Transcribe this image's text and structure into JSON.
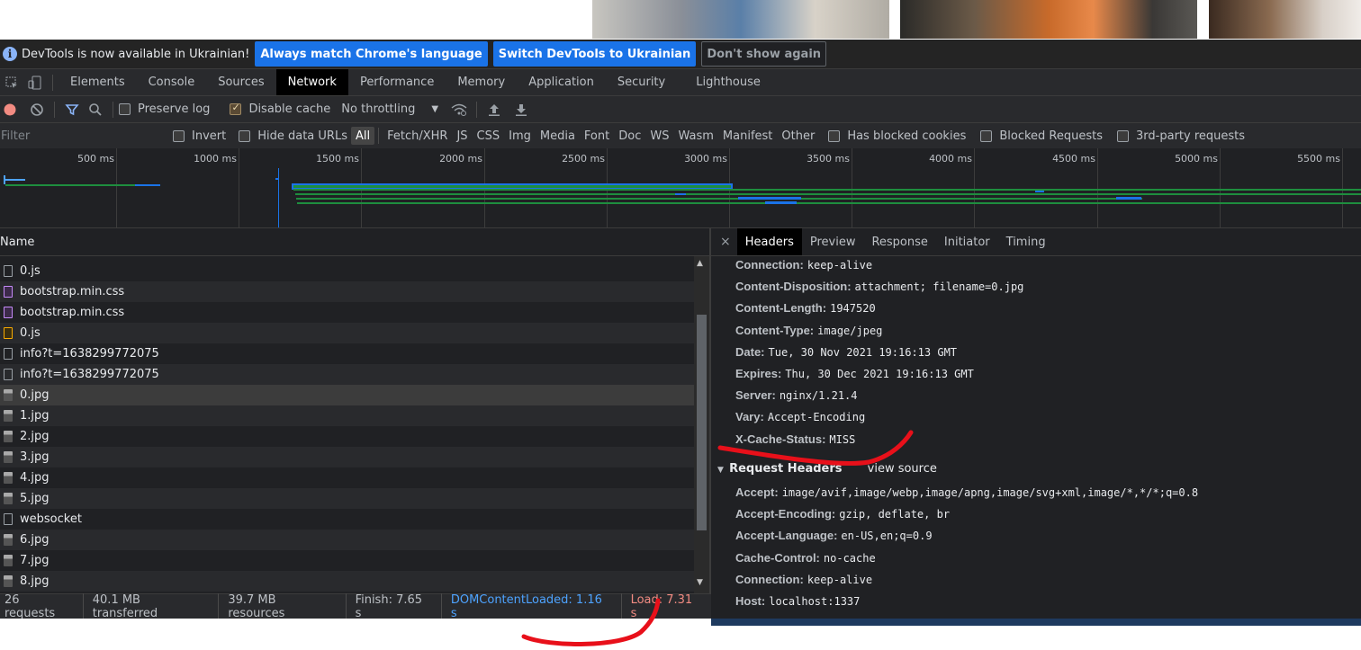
{
  "infobar": {
    "message": "DevTools is now available in Ukrainian!",
    "btn_match": "Always match Chrome's language",
    "btn_switch": "Switch DevTools to Ukrainian",
    "btn_dismiss": "Don't show again"
  },
  "tabs": [
    "Elements",
    "Console",
    "Sources",
    "Network",
    "Performance",
    "Memory",
    "Application",
    "Security",
    "Lighthouse"
  ],
  "active_tab": "Network",
  "toolbar": {
    "preserve_log": "Preserve log",
    "disable_cache": "Disable cache",
    "throttling": "No throttling"
  },
  "filterbar": {
    "placeholder": "Filter",
    "invert": "Invert",
    "hide_data_urls": "Hide data URLs",
    "types": [
      "All",
      "Fetch/XHR",
      "JS",
      "CSS",
      "Img",
      "Media",
      "Font",
      "Doc",
      "WS",
      "Wasm",
      "Manifest",
      "Other"
    ],
    "has_blocked_cookies": "Has blocked cookies",
    "blocked_requests": "Blocked Requests",
    "third_party": "3rd-party requests"
  },
  "overview": {
    "ticks": [
      "500 ms",
      "1000 ms",
      "1500 ms",
      "2000 ms",
      "2500 ms",
      "3000 ms",
      "3500 ms",
      "4000 ms",
      "4500 ms",
      "5000 ms",
      "5500 ms"
    ]
  },
  "requests": {
    "column_name": "Name",
    "rows": [
      {
        "name": "0.js",
        "type": "doc"
      },
      {
        "name": "bootstrap.min.css",
        "type": "css"
      },
      {
        "name": "bootstrap.min.css",
        "type": "css"
      },
      {
        "name": "0.js",
        "type": "js"
      },
      {
        "name": "info?t=1638299772075",
        "type": "doc"
      },
      {
        "name": "info?t=1638299772075",
        "type": "doc"
      },
      {
        "name": "0.jpg",
        "type": "img"
      },
      {
        "name": "1.jpg",
        "type": "img"
      },
      {
        "name": "2.jpg",
        "type": "img"
      },
      {
        "name": "3.jpg",
        "type": "img"
      },
      {
        "name": "4.jpg",
        "type": "img"
      },
      {
        "name": "5.jpg",
        "type": "img"
      },
      {
        "name": "websocket",
        "type": "doc"
      },
      {
        "name": "6.jpg",
        "type": "img"
      },
      {
        "name": "7.jpg",
        "type": "img"
      },
      {
        "name": "8.jpg",
        "type": "img"
      }
    ]
  },
  "status": {
    "requests": "26 requests",
    "transferred": "40.1 MB transferred",
    "resources": "39.7 MB resources",
    "finish": "Finish: 7.65 s",
    "dcl": "DOMContentLoaded: 1.16 s",
    "load": "Load: 7.31 s",
    "dcl_color": "#4da3ff",
    "load_color": "#f28b82"
  },
  "details": {
    "tabs": [
      "Headers",
      "Preview",
      "Response",
      "Initiator",
      "Timing"
    ],
    "close": "×",
    "response_headers": [
      {
        "name": "Connection:",
        "value": "keep-alive"
      },
      {
        "name": "Content-Disposition:",
        "value": "attachment; filename=0.jpg"
      },
      {
        "name": "Content-Length:",
        "value": "1947520"
      },
      {
        "name": "Content-Type:",
        "value": "image/jpeg"
      },
      {
        "name": "Date:",
        "value": "Tue, 30 Nov 2021 19:16:13 GMT"
      },
      {
        "name": "Expires:",
        "value": "Thu, 30 Dec 2021 19:16:13 GMT"
      },
      {
        "name": "Server:",
        "value": "nginx/1.21.4"
      },
      {
        "name": "Vary:",
        "value": "Accept-Encoding"
      },
      {
        "name": "X-Cache-Status:",
        "value": "MISS"
      }
    ],
    "request_section": "Request Headers",
    "view_source": "view source",
    "request_headers": [
      {
        "name": "Accept:",
        "value": "image/avif,image/webp,image/apng,image/svg+xml,image/*,*/*;q=0.8"
      },
      {
        "name": "Accept-Encoding:",
        "value": "gzip, deflate, br"
      },
      {
        "name": "Accept-Language:",
        "value": "en-US,en;q=0.9"
      },
      {
        "name": "Cache-Control:",
        "value": "no-cache"
      },
      {
        "name": "Connection:",
        "value": "keep-alive"
      },
      {
        "name": "Host:",
        "value": "localhost:1337"
      }
    ]
  },
  "annotation_color": "#e8101a"
}
